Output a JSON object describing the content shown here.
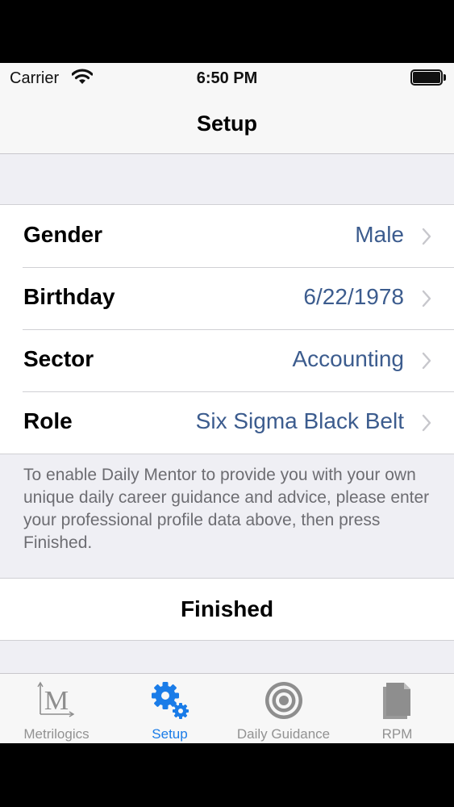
{
  "status_bar": {
    "carrier": "Carrier",
    "time": "6:50 PM",
    "icons": [
      "wifi-icon",
      "battery-icon"
    ]
  },
  "nav": {
    "title": "Setup"
  },
  "profile": {
    "rows": [
      {
        "label": "Gender",
        "value": "Male"
      },
      {
        "label": "Birthday",
        "value": "6/22/1978"
      },
      {
        "label": "Sector",
        "value": "Accounting"
      },
      {
        "label": "Role",
        "value": "Six Sigma Black Belt"
      }
    ],
    "footer": "To enable Daily Mentor to provide you with your own unique daily career guidance and advice, please enter your professional profile data above, then press Finished."
  },
  "finished_label": "Finished",
  "tabs": [
    {
      "label": "Metrilogics",
      "icon": "metrilogics-logo-icon",
      "active": false
    },
    {
      "label": "Setup",
      "icon": "gears-icon",
      "active": true
    },
    {
      "label": "Daily Guidance",
      "icon": "target-icon",
      "active": false
    },
    {
      "label": "RPM",
      "icon": "documents-icon",
      "active": false
    }
  ],
  "colors": {
    "accent": "#1a7ce8",
    "value_text": "#3c5c8e",
    "inactive_tab": "#929292",
    "background": "#efeff4"
  }
}
